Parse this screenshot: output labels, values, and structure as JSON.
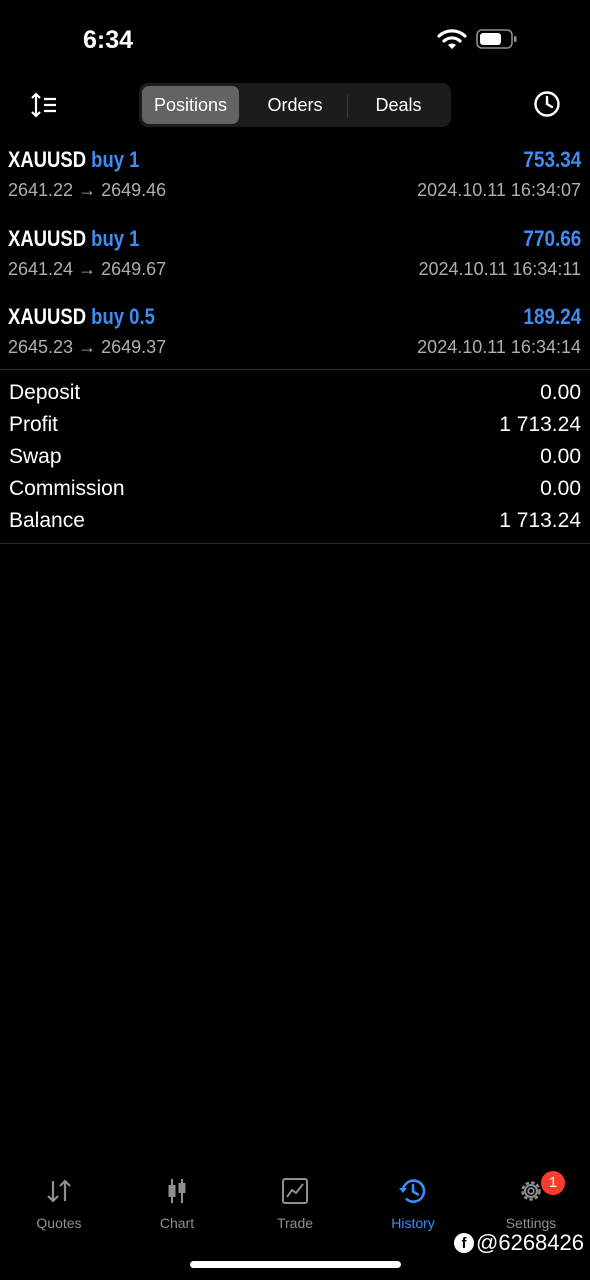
{
  "status_bar": {
    "time": "6:34"
  },
  "segments": [
    "Positions",
    "Orders",
    "Deals"
  ],
  "positions": [
    {
      "symbol": "XAUUSD",
      "direction": "buy 1",
      "profit": "753.34",
      "prices": "2641.22 → 2649.46",
      "time": "2024.10.11 16:34:07"
    },
    {
      "symbol": "XAUUSD",
      "direction": "buy 1",
      "profit": "770.66",
      "prices": "2641.24 → 2649.67",
      "time": "2024.10.11 16:34:11"
    },
    {
      "symbol": "XAUUSD",
      "direction": "buy 0.5",
      "profit": "189.24",
      "prices": "2645.23 → 2649.37",
      "time": "2024.10.11 16:34:14"
    }
  ],
  "summary": [
    {
      "label": "Deposit",
      "value": "0.00"
    },
    {
      "label": "Profit",
      "value": "1 713.24"
    },
    {
      "label": "Swap",
      "value": "0.00"
    },
    {
      "label": "Commission",
      "value": "0.00"
    },
    {
      "label": "Balance",
      "value": "1 713.24"
    }
  ],
  "tabs": [
    "Quotes",
    "Chart",
    "Trade",
    "History",
    "Settings"
  ],
  "settings_badge": "1",
  "watermark": "@6268426",
  "colors": {
    "accent": "#3d8df5",
    "background": "#000000",
    "badge": "#ff3b30"
  }
}
